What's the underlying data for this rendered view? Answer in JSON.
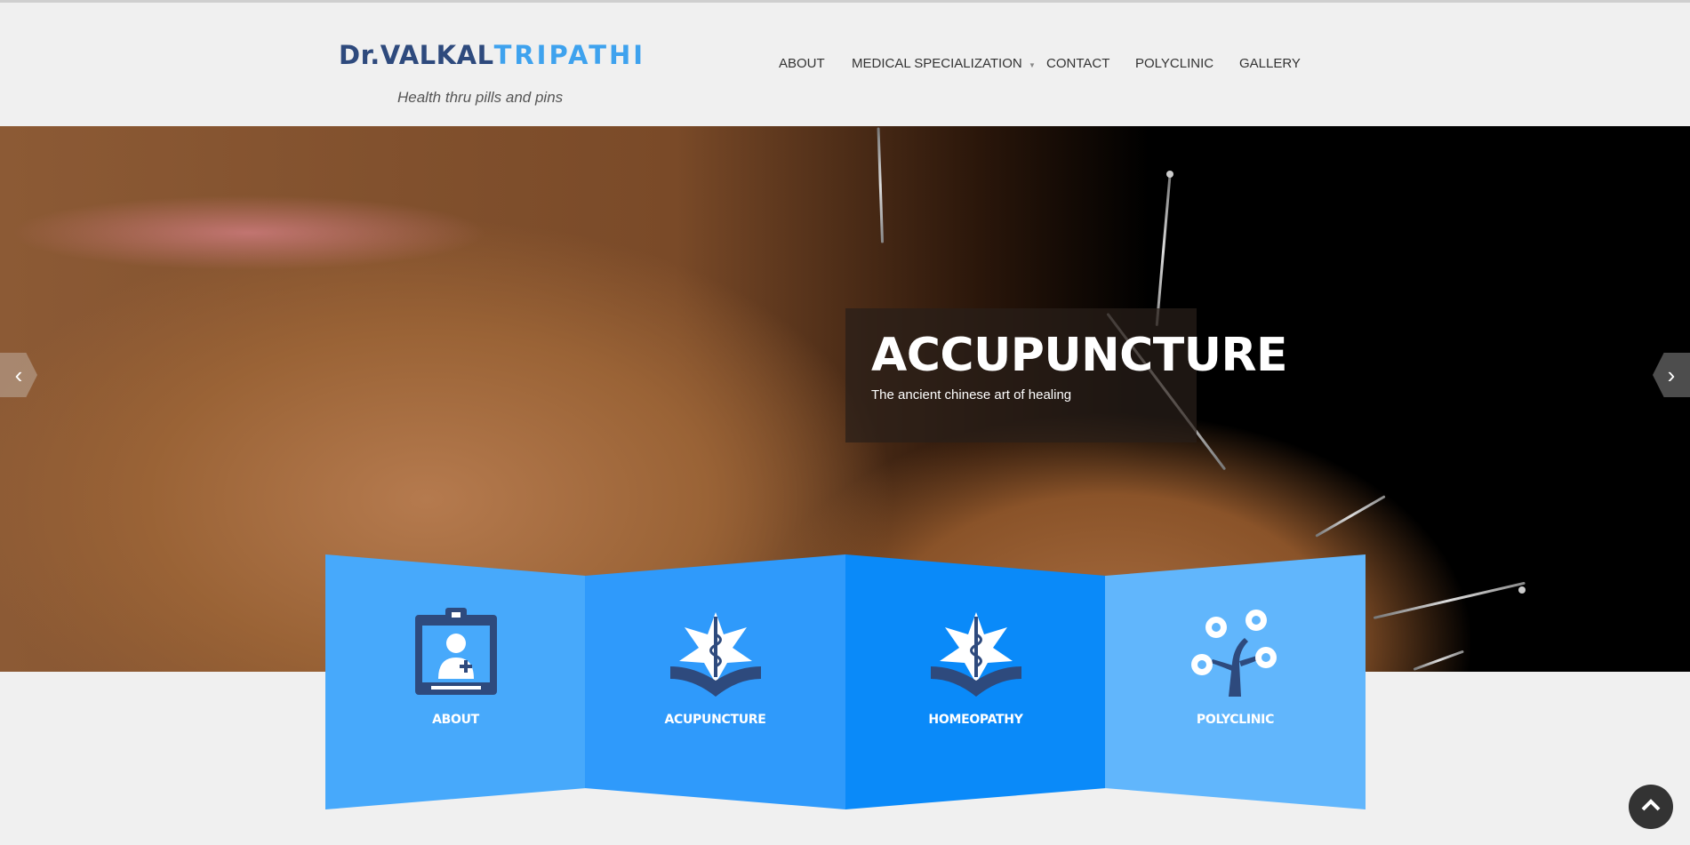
{
  "brand": {
    "name_part1": "Dr.VALKAL",
    "name_part2": "TRIPATHI",
    "tagline": "Health thru pills and pins"
  },
  "nav": {
    "items": [
      {
        "label": "ABOUT"
      },
      {
        "label": "MEDICAL SPECIALIZATION",
        "has_dropdown": true
      },
      {
        "label": "CONTACT"
      },
      {
        "label": "POLYCLINIC"
      },
      {
        "label": "GALLERY"
      }
    ]
  },
  "slider": {
    "title": "ACCUPUNCTURE",
    "subtitle": "The ancient chinese art of healing",
    "prev_icon": "chevron-left-icon",
    "next_icon": "chevron-right-icon"
  },
  "features": [
    {
      "label": "ABOUT",
      "icon": "doctor-id-badge-icon",
      "color": "#47a9fb"
    },
    {
      "label": "ACUPUNCTURE",
      "icon": "medical-star-book-icon",
      "color": "#2f9afb"
    },
    {
      "label": "HOMEOPATHY",
      "icon": "medical-star-book-icon",
      "color": "#0a8af9"
    },
    {
      "label": "POLYCLINIC",
      "icon": "gear-tree-icon",
      "color": "#61b6fc"
    }
  ],
  "back_to_top": {
    "icon": "chevron-up-icon"
  },
  "colors": {
    "brand_dark": "#2e4a7d",
    "brand_light": "#3ea2ee",
    "icon_dark": "#2e4a7d",
    "page_bg": "#f0f0f0"
  }
}
